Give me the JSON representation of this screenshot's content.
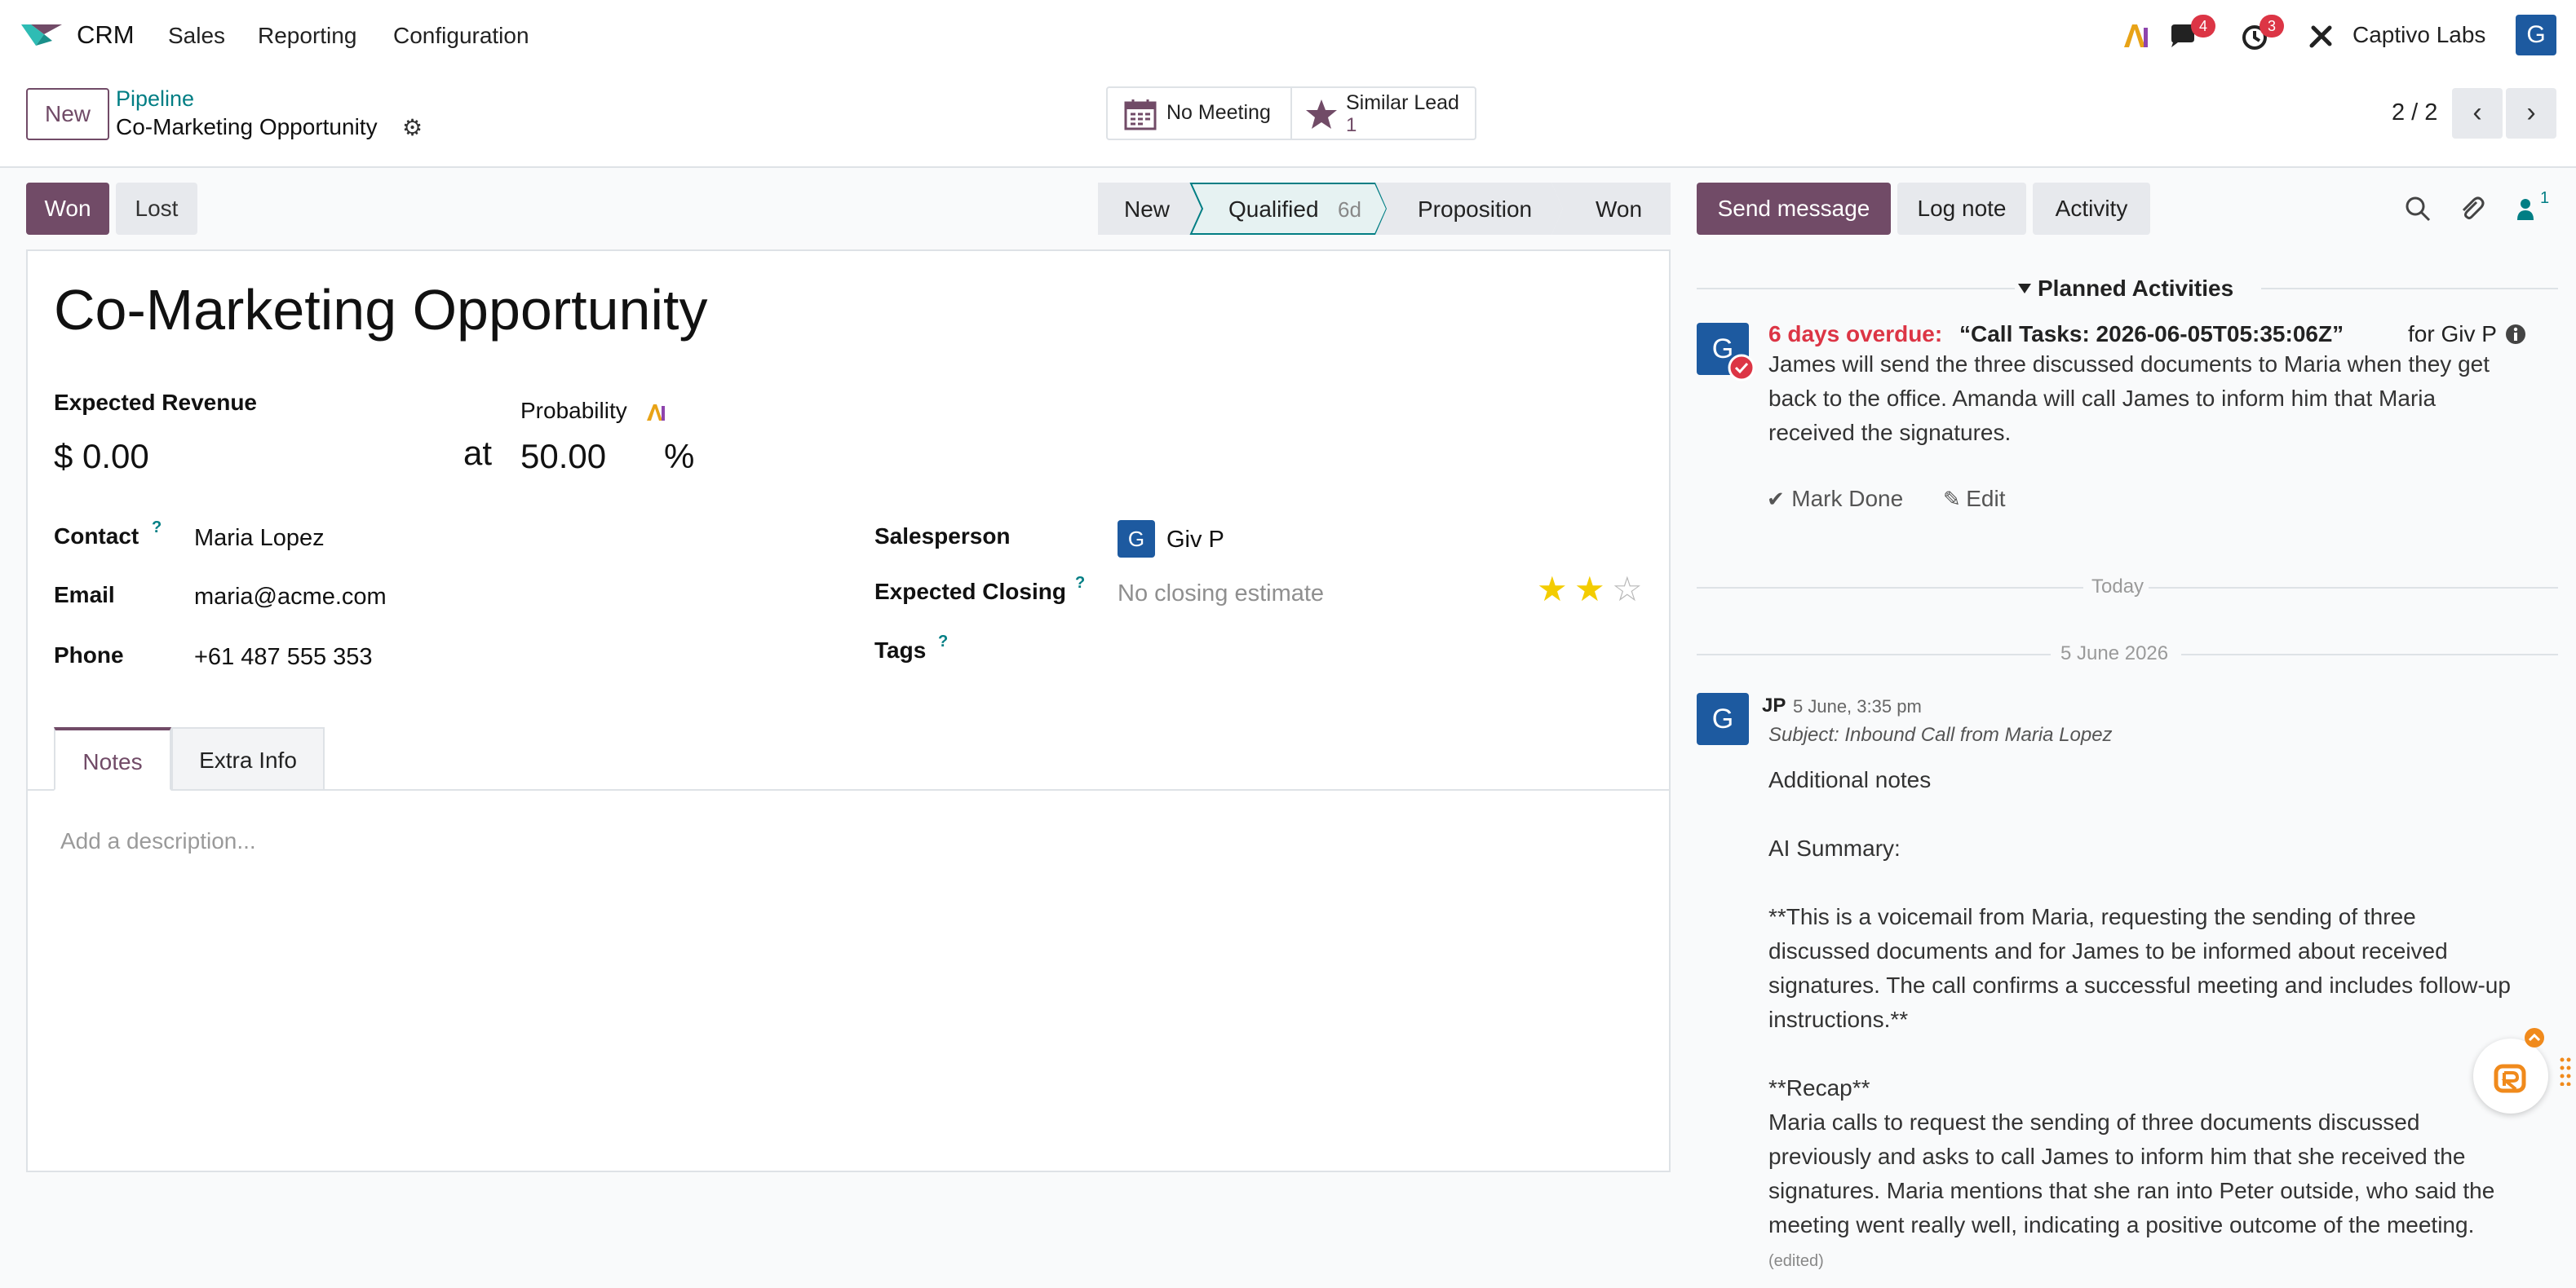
{
  "navbar": {
    "app_name": "CRM",
    "menu": [
      "Sales",
      "Reporting",
      "Configuration"
    ],
    "messages_count": "4",
    "activities_count": "3",
    "company": "Captivo Labs",
    "user_initial": "G",
    "icons": [
      "crm-logo",
      "ai-icon",
      "chat-icon",
      "clock-icon",
      "tools-icon"
    ]
  },
  "control_panel": {
    "new_label": "New",
    "breadcrumb_parent": "Pipeline",
    "breadcrumb_current": "Co-Marketing Opportunity",
    "meeting_label": "No Meeting",
    "similar_label": "Similar Lead",
    "similar_count": "1",
    "pager": "2 / 2"
  },
  "statusbar": {
    "won_label": "Won",
    "lost_label": "Lost",
    "stages": [
      {
        "label": "New",
        "duration": ""
      },
      {
        "label": "Qualified",
        "duration": "6d"
      },
      {
        "label": "Proposition",
        "duration": ""
      },
      {
        "label": "Won",
        "duration": ""
      }
    ],
    "active_stage": "Qualified"
  },
  "form": {
    "title": "Co-Marketing Opportunity",
    "expected_revenue_label": "Expected Revenue",
    "expected_revenue": "$ 0.00",
    "at_label": "at",
    "probability_label": "Probability",
    "probability": "50.00",
    "percent": "%",
    "contact_label": "Contact",
    "contact": "Maria Lopez",
    "email_label": "Email",
    "email": "maria@acme.com",
    "phone_label": "Phone",
    "phone": "+61 487 555 353",
    "salesperson_label": "Salesperson",
    "salesperson": "Giv P",
    "salesperson_initial": "G",
    "closing_label": "Expected Closing",
    "closing_placeholder": "No closing estimate",
    "tags_label": "Tags",
    "help_mark": "?",
    "priority_stars": 2,
    "priority_max": 3,
    "tabs": [
      "Notes",
      "Extra Info"
    ],
    "description_placeholder": "Add a description..."
  },
  "chatter": {
    "send_label": "Send message",
    "log_label": "Log note",
    "activity_label": "Activity",
    "followers_count": "1",
    "planned_header": "Planned Activities",
    "activity": {
      "overdue": "6 days overdue:",
      "summary": "“Call Tasks: 2026-06-05T05:35:06Z”",
      "for_text": "for Giv P",
      "note_lines": [
        "James will send the three discussed documents to Maria when they get",
        "back to the office. Amanda will call James to inform him that Maria",
        "received the signatures."
      ],
      "mark_done": "Mark Done",
      "edit": "Edit",
      "avatar_initial": "G"
    },
    "today_label": "Today",
    "date_label": "5 June 2026",
    "message": {
      "author": "JP",
      "date": "5 June, 3:35 pm",
      "subject": "Subject: Inbound Call from Maria Lopez",
      "avatar_initial": "G",
      "lines": [
        "Additional notes",
        "",
        "AI Summary:",
        "",
        "**This is a voicemail from Maria, requesting the sending of three",
        "discussed documents and for James to be informed about received",
        "signatures. The call confirms a successful meeting and includes follow-up",
        "instructions.**",
        "",
        "**Recap**",
        "Maria calls to request the sending of three documents discussed",
        "previously and asks to call James to inform him that she received the",
        "signatures. Maria mentions that she ran into Peter outside, who said the",
        "meeting went really well, indicating a positive outcome of the meeting."
      ],
      "edited": "(edited)"
    }
  },
  "colors": {
    "brand": "#714b67",
    "teal": "#017e84",
    "danger": "#dc3545",
    "star": "#f3cc00",
    "avatar": "#1d5aa0"
  }
}
